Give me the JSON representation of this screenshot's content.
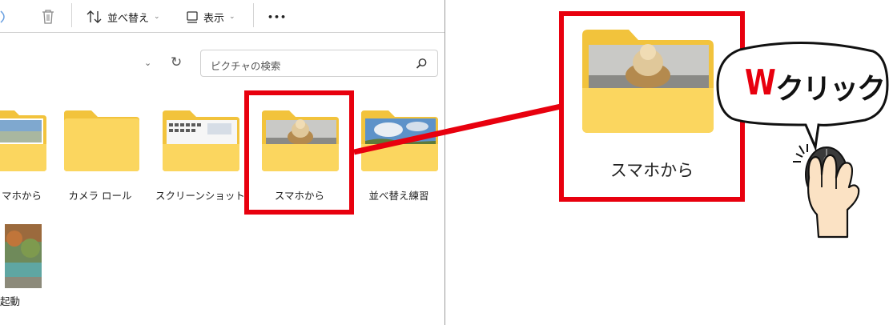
{
  "toolbar": {
    "sort_label": "並べ替え",
    "view_label": "表示",
    "more_label": "•••"
  },
  "search": {
    "placeholder": "ピクチャの検索"
  },
  "files": [
    {
      "label": "マホから",
      "type": "folder-photo"
    },
    {
      "label": "カメラ ロール",
      "type": "folder"
    },
    {
      "label": "スクリーンショット",
      "type": "folder-screenshots"
    },
    {
      "label": "スマホから",
      "type": "folder-photo",
      "highlighted": true
    },
    {
      "label": "並べ替え練習",
      "type": "folder-sky"
    },
    {
      "label": "起動",
      "type": "image"
    }
  ],
  "zoom": {
    "label": "スマホから"
  },
  "callout": {
    "w_mark": "W",
    "click_text": "クリック"
  },
  "colors": {
    "highlight": "#e8000e",
    "folder_back": "#f2c33c",
    "folder_front": "#fbd65f"
  },
  "icons": [
    "trash-icon",
    "sort-icon",
    "view-icon",
    "more-icon",
    "chevron-down-icon",
    "refresh-icon",
    "search-icon",
    "folder-icon",
    "mouse-hand-icon"
  ]
}
